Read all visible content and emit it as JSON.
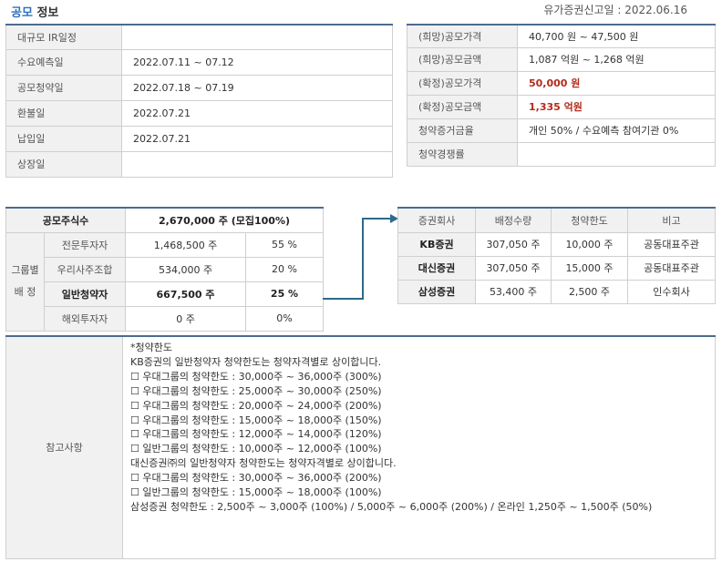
{
  "header": {
    "title_accent": "공모",
    "title_rest": " 정보",
    "filing_label": "유가증권신고일 :",
    "filing_date": "2022.06.16"
  },
  "schedule": [
    {
      "label": "대규모 IR일정",
      "value": ""
    },
    {
      "label": "수요예측일",
      "value": "2022.07.11 ~ 07.12"
    },
    {
      "label": "공모청약일",
      "value": "2022.07.18 ~ 07.19"
    },
    {
      "label": "환불일",
      "value": "2022.07.21"
    },
    {
      "label": "납입일",
      "value": "2022.07.21"
    },
    {
      "label": "상장일",
      "value": ""
    }
  ],
  "pricing": [
    {
      "label": "(희망)공모가격",
      "value": "40,700 원 ~ 47,500 원",
      "highlight": false
    },
    {
      "label": "(희망)공모금액",
      "value": "1,087 억원  ~ 1,268 억원",
      "highlight": false
    },
    {
      "label": "(확정)공모가격",
      "value": "50,000 원",
      "highlight": true
    },
    {
      "label": "(확정)공모금액",
      "value": "1,335 억원",
      "highlight": true
    },
    {
      "label": "청약증거금율",
      "value": "개인 50% / 수요예측 참여기관 0%",
      "highlight": false
    },
    {
      "label": "청약경쟁률",
      "value": "",
      "highlight": false
    }
  ],
  "allocation": {
    "total_label": "공모주식수",
    "total_value": "2,670,000 주 (모집100%)",
    "group_label_1": "그룹별",
    "group_label_2": "배 정",
    "rows": [
      {
        "name": "전문투자자",
        "shares": "1,468,500 주",
        "pct": "55 %",
        "bold": false
      },
      {
        "name": "우리사주조합",
        "shares": "534,000 주",
        "pct": "20 %",
        "bold": false
      },
      {
        "name": "일반청약자",
        "shares": "667,500 주",
        "pct": "25 %",
        "bold": true
      },
      {
        "name": "해외투자자",
        "shares": "0 주",
        "pct": "0%",
        "bold": false
      }
    ]
  },
  "brokers": {
    "headers": [
      "증권회사",
      "배정수량",
      "청약한도",
      "비고"
    ],
    "rows": [
      {
        "name": "KB증권",
        "qty": "307,050 주",
        "limit": "10,000 주",
        "note": "공동대표주관"
      },
      {
        "name": "대신증권",
        "qty": "307,050 주",
        "limit": "15,000 주",
        "note": "공동대표주관"
      },
      {
        "name": "삼성증권",
        "qty": "53,400 주",
        "limit": "2,500 주",
        "note": "인수회사"
      }
    ]
  },
  "notes": {
    "label": "참고사항",
    "lines": [
      "*청약한도",
      "",
      "KB증권의 일반청약자 청약한도는 청약자격별로 상이합니다.",
      "☐ 우대그룹의 청약한도 : 30,000주 ~ 36,000주 (300%)",
      "☐ 우대그룹의 청약한도 : 25,000주 ~ 30,000주 (250%)",
      "☐ 우대그룹의 청약한도 : 20,000주 ~ 24,000주 (200%)",
      "☐ 우대그룹의 청약한도 : 15,000주 ~ 18,000주 (150%)",
      "☐ 우대그룹의 청약한도 : 12,000주 ~ 14,000주 (120%)",
      "☐ 일반그룹의 청약한도 : 10,000주 ~ 12,000주 (100%)",
      "",
      "대신증권㈜의 일반청약자 청약한도는 청약자격별로 상이합니다.",
      "☐ 우대그룹의 청약한도 : 30,000주 ~ 36,000주 (200%)",
      "☐ 일반그룹의 청약한도 : 15,000주 ~ 18,000주 (100%)",
      "",
      "삼성증권 청약한도 : 2,500주 ~ 3,000주 (100%) / 5,000주 ~ 6,000주 (200%) / 온라인 1,250주 ~ 1,500주 (50%)"
    ]
  },
  "colors": {
    "accent": "#2d6fc0",
    "border_top": "#4d6a8e",
    "highlight": "#b22b1c",
    "arrow": "#2e6a8a"
  }
}
